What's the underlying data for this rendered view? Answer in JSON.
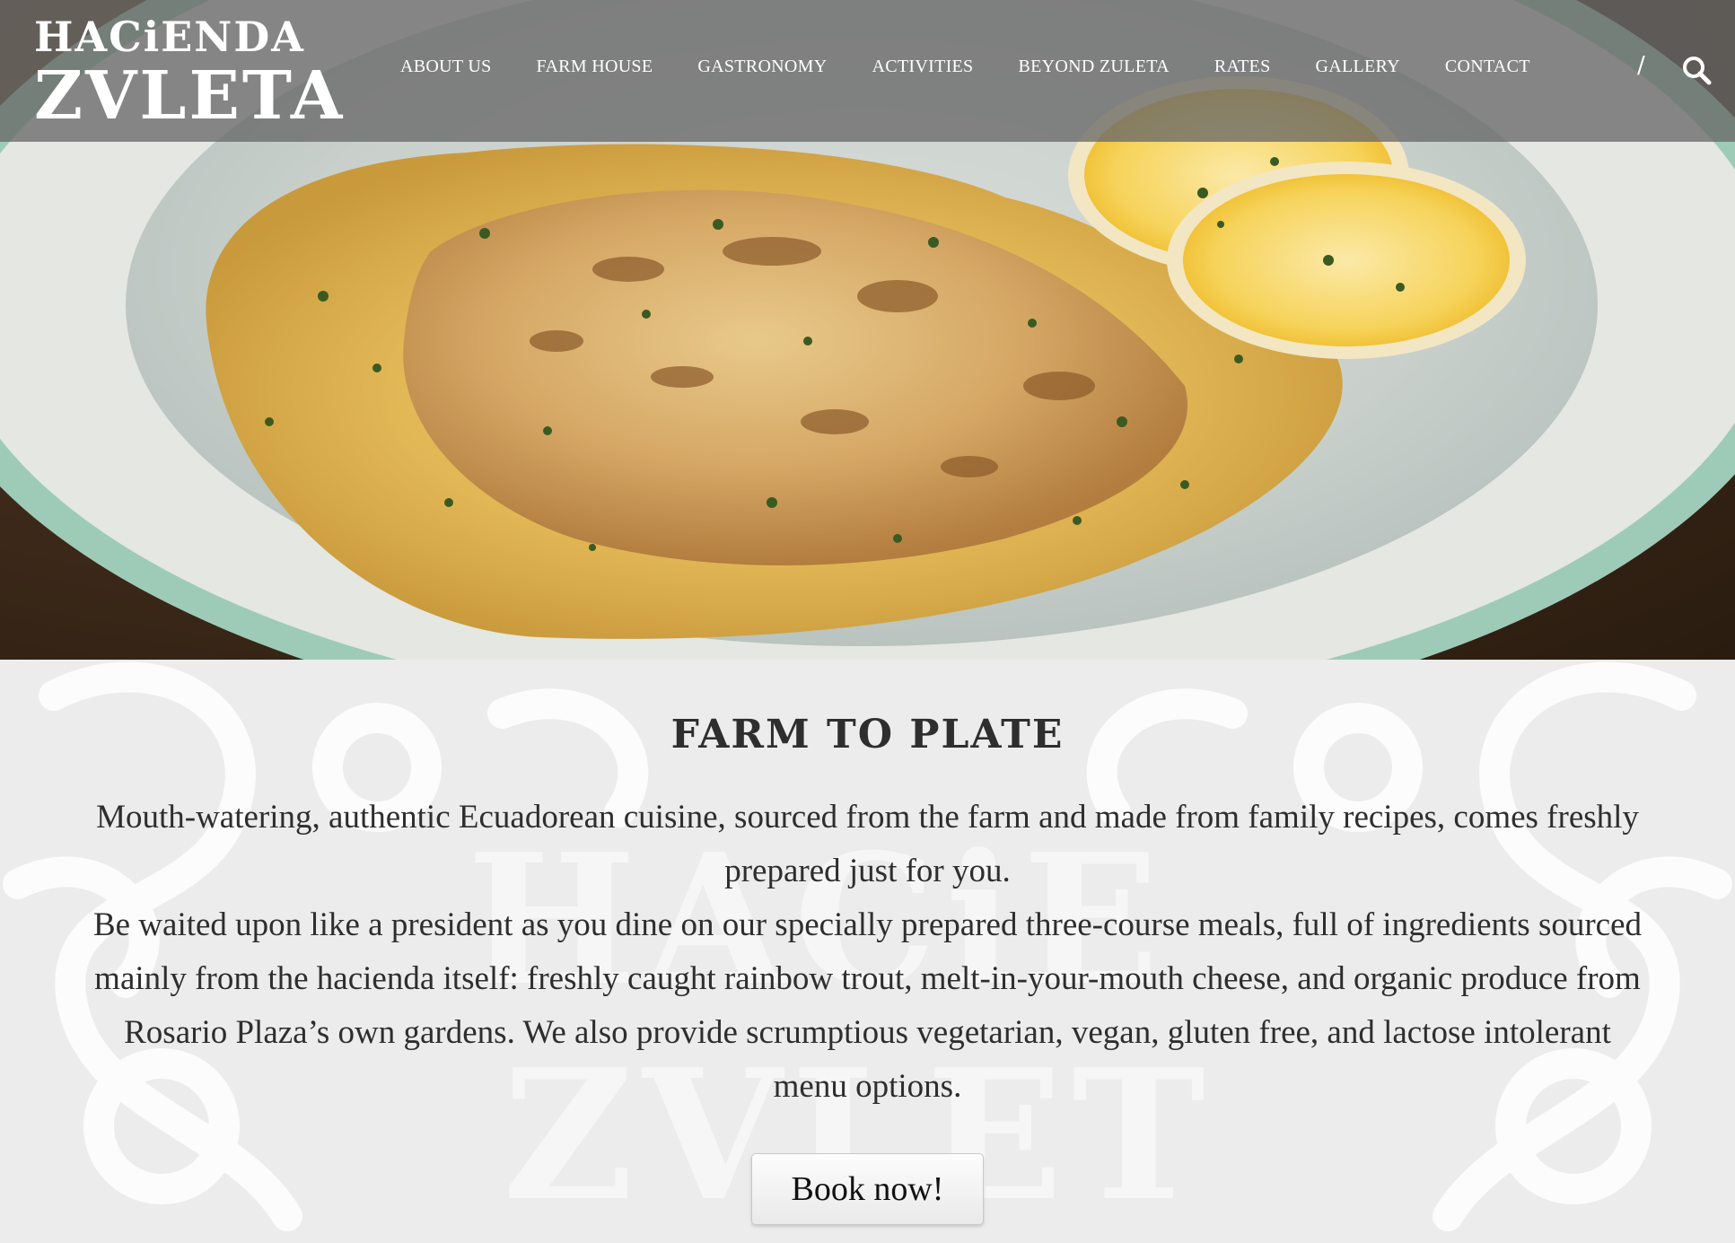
{
  "brand": {
    "logo_line1": "HACiENDA",
    "logo_line2": "ZVLETA"
  },
  "nav": {
    "items": [
      {
        "label": "ABOUT US"
      },
      {
        "label": "FARM HOUSE"
      },
      {
        "label": "GASTRONOMY"
      },
      {
        "label": "ACTIVITIES"
      },
      {
        "label": "BEYOND ZULETA"
      },
      {
        "label": "RATES"
      },
      {
        "label": "GALLERY"
      },
      {
        "label": "CONTACT"
      }
    ],
    "divider": "/",
    "search_icon": "search-icon"
  },
  "hero": {
    "image": "plate-of-baked-fish-with-cheese-sauce-and-lemon-slices"
  },
  "section": {
    "title": "FARM TO PLATE",
    "paragraph1": "Mouth-watering, authentic Ecuadorean cuisine, sourced from the farm and made from family recipes, comes freshly prepared just for you.",
    "paragraph2": "Be waited upon like a president as you dine on our specially prepared three-course meals, full of ingredients sourced mainly from the hacienda itself: freshly caught rainbow trout, melt-in-your-mouth cheese, and organic produce from Rosario Plaza’s own gardens. We also provide scrumptious vegetarian, vegan, gluten free, and lactose intolerant menu options.",
    "cta_label": "Book now!"
  },
  "colors": {
    "header_overlay": "#696969",
    "content_bg": "#ececec",
    "text": "#2e2e2e",
    "plate_rim": "#9ecbb8",
    "sauce": "#e2b756",
    "lemon": "#f6d35a"
  }
}
